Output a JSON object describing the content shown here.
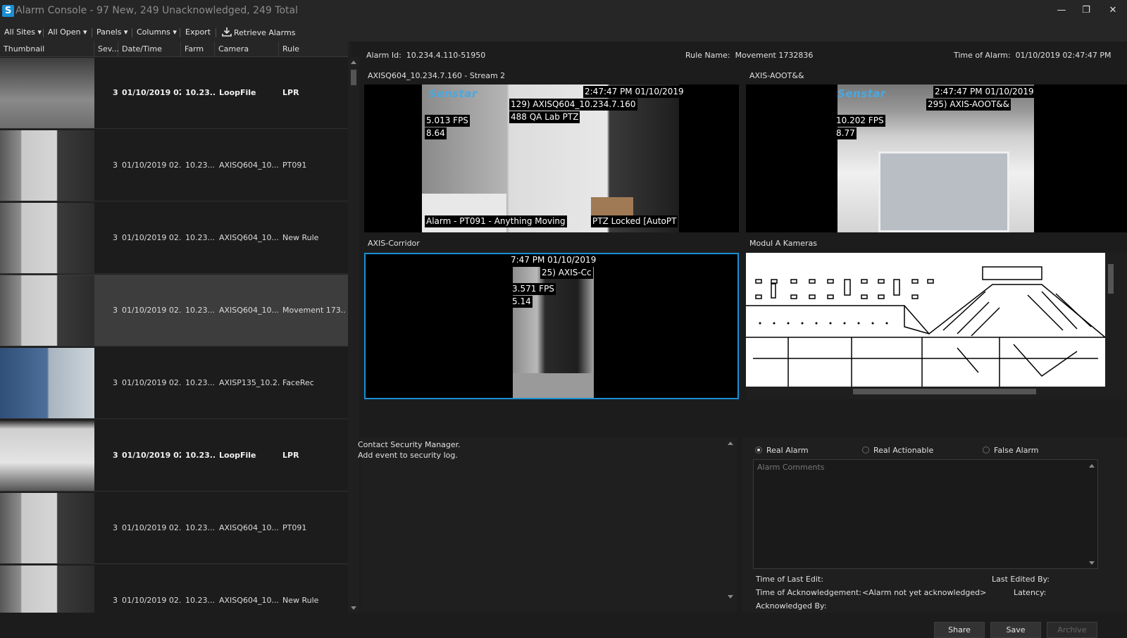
{
  "window": {
    "title": "Alarm Console - 97 New, 249 Unacknowledged, 249 Total",
    "logo_letter": "S",
    "minimize": "—",
    "restore": "❐",
    "close": "✕"
  },
  "toolbar": {
    "all_sites": "All Sites ▾",
    "all_open": "All Open ▾",
    "panels": "Panels ▾",
    "columns": "Columns ▾",
    "export": "Export",
    "retrieve": "Retrieve Alarms"
  },
  "table": {
    "headers": [
      "Thumbnail",
      "Sev...",
      "Date/Time",
      "Farm",
      "Camera",
      "Rule"
    ],
    "rows": [
      {
        "sev": "3",
        "datetime": "01/10/2019 02...",
        "farm": "10.23...",
        "camera": "LoopFile",
        "rule": "LPR",
        "bold": true,
        "selected": false,
        "thumb": "lpr"
      },
      {
        "sev": "3",
        "datetime": "01/10/2019 02...",
        "farm": "10.23...",
        "camera": "AXISQ604_10....",
        "rule": "PT091",
        "bold": false,
        "selected": false,
        "thumb": "room"
      },
      {
        "sev": "3",
        "datetime": "01/10/2019 02...",
        "farm": "10.23...",
        "camera": "AXISQ604_10....",
        "rule": "New Rule",
        "bold": false,
        "selected": false,
        "thumb": "room"
      },
      {
        "sev": "3",
        "datetime": "01/10/2019 02...",
        "farm": "10.23...",
        "camera": "AXISQ604_10....",
        "rule": "Movement 173...",
        "bold": false,
        "selected": true,
        "thumb": "room"
      },
      {
        "sev": "3",
        "datetime": "01/10/2019 02...",
        "farm": "10.23...",
        "camera": "AXISP135_10.2...",
        "rule": "FaceRec",
        "bold": false,
        "selected": false,
        "thumb": "face"
      },
      {
        "sev": "3",
        "datetime": "01/10/2019 02...",
        "farm": "10.23...",
        "camera": "LoopFile",
        "rule": "LPR",
        "bold": true,
        "selected": false,
        "thumb": "truck"
      },
      {
        "sev": "3",
        "datetime": "01/10/2019 02...",
        "farm": "10.23...",
        "camera": "AXISQ604_10....",
        "rule": "PT091",
        "bold": false,
        "selected": false,
        "thumb": "room"
      },
      {
        "sev": "3",
        "datetime": "01/10/2019 02...",
        "farm": "10.23...",
        "camera": "AXISQ604_10....",
        "rule": "New Rule",
        "bold": false,
        "selected": false,
        "thumb": "room"
      }
    ]
  },
  "alarm": {
    "id_label": "Alarm Id:",
    "id_value": "10.234.4.110-51950",
    "rule_label": "Rule Name:",
    "rule_value": "Movement 1732836",
    "time_label": "Time of Alarm:",
    "time_value": "01/10/2019 02:47:47 PM"
  },
  "panels": {
    "p1": {
      "title": "AXISQ604_10.234.7.160 - Stream 2",
      "logo": "Senstar",
      "time": "2:47:47 PM 01/10/2019",
      "cam": "129) AXISQ604_10.234.7.160",
      "cam2": "488 QA Lab PTZ",
      "fps": "5.013 FPS",
      "fps2": "8.64",
      "alarm": "Alarm - PT091 - Anything Moving",
      "ptz": "PTZ Locked [AutoPT"
    },
    "p2": {
      "title": "AXIS-AOOT&&",
      "logo": "Senstar",
      "time": "2:47:47 PM 01/10/2019",
      "cam": "295) AXIS-AOOT&&",
      "fps": "10.202 FPS",
      "fps2": "8.77"
    },
    "p3": {
      "title": "AXIS-Corridor",
      "time": "7:47 PM 01/10/2019",
      "cam": "25) AXIS-Cc",
      "fps": "3.571 FPS",
      "fps2": "5.14"
    },
    "p4": {
      "title": "Modul A Kameras"
    }
  },
  "notes": {
    "line1": "Contact Security Manager.",
    "line2": "Add event to security log."
  },
  "ack": {
    "real_alarm": "Real Alarm",
    "real_actionable": "Real Actionable",
    "false_alarm": "False Alarm",
    "comments_placeholder": "Alarm Comments",
    "last_edit": "Time of Last Edit:",
    "last_edited_by": "Last Edited By:",
    "ack_time": "Time of Acknowledgement:",
    "ack_time_value": "<Alarm not yet acknowledged>",
    "latency": "Latency:",
    "ack_by": "Acknowledged By:",
    "share": "Share",
    "save": "Save",
    "archive": "Archive"
  },
  "colors": {
    "accent": "#1a8fd6",
    "selected_row": "#3d3d3d",
    "senstar": "#4aa8e0"
  }
}
